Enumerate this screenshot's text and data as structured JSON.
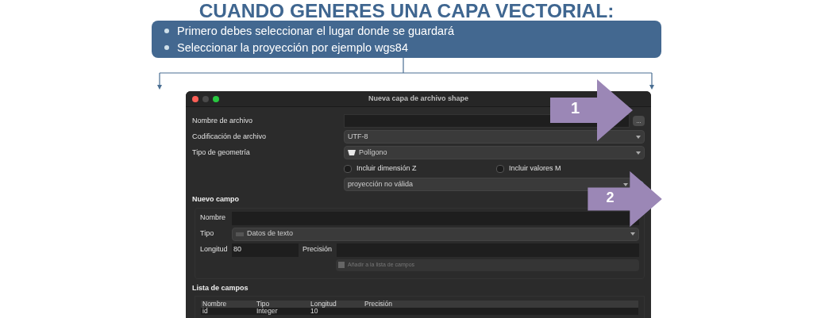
{
  "slide": {
    "title": "CUANDO GENERES UNA CAPA VECTORIAL:",
    "bullets": [
      "Primero debes seleccionar el lugar donde se guardará",
      "Seleccionar la proyección por ejemplo wgs84"
    ]
  },
  "dialog": {
    "title": "Nueva capa de archivo shape",
    "file_name": {
      "label": "Nombre de archivo",
      "browse": "..."
    },
    "encoding": {
      "label": "Codificación de archivo",
      "value": "UTF-8"
    },
    "geometry": {
      "label": "Tipo de geometría",
      "value": "Polígono"
    },
    "options": [
      {
        "label": "Incluir dimensión Z",
        "checked": false
      },
      {
        "label": "Incluir valores M",
        "checked": false
      }
    ],
    "crs": {
      "value": "proyección no válida"
    },
    "new_field": {
      "heading": "Nuevo campo",
      "name_label": "Nombre",
      "type_label": "Tipo",
      "type_value": "Datos de texto",
      "length_label": "Longitud",
      "length_value": "80",
      "precision_label": "Precisión",
      "add_button": {
        "label": "Añadir a la lista de campos",
        "disabled": true
      }
    },
    "field_list": {
      "heading": "Lista de campos",
      "columns": [
        "Nombre",
        "Tipo",
        "Longitud",
        "Precisión"
      ],
      "rows": [
        [
          "id",
          "Integer",
          "10",
          ""
        ]
      ]
    }
  },
  "callouts": [
    {
      "number": "1"
    },
    {
      "number": "2"
    }
  ]
}
